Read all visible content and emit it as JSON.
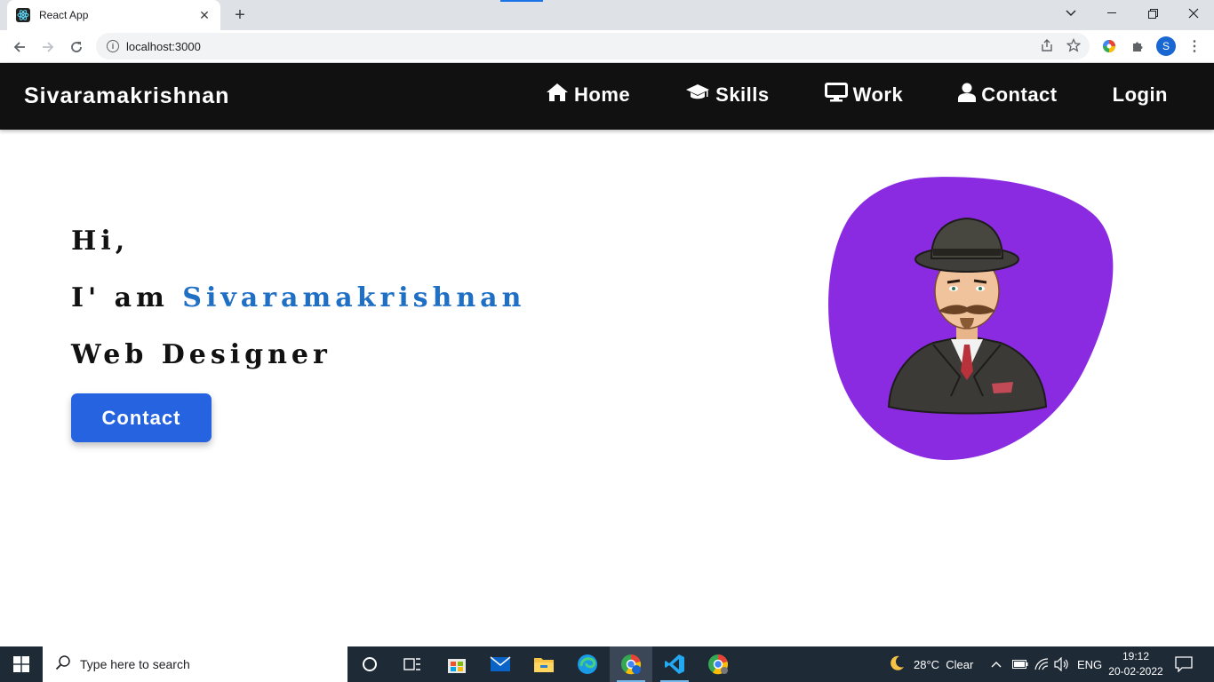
{
  "browser": {
    "tab_title": "React App",
    "url": "localhost:3000",
    "profile_initial": "S"
  },
  "site": {
    "brand": "Sivaramakrishnan",
    "menu": [
      {
        "label": "Home",
        "icon": "home-icon"
      },
      {
        "label": "Skills",
        "icon": "graduation-cap-icon"
      },
      {
        "label": "Work",
        "icon": "desktop-icon"
      },
      {
        "label": "Contact",
        "icon": "user-icon"
      },
      {
        "label": "Login",
        "icon": ""
      }
    ]
  },
  "hero": {
    "greeting": "Hi,",
    "intro_prefix": "I' am",
    "name": "Sivaramakrishnan",
    "role": "Web Designer",
    "contact_button": "Contact",
    "name_color": "#1f6fc5",
    "blob_color": "#8a2be2",
    "button_color": "#2563e0"
  },
  "taskbar": {
    "search_placeholder": "Type here to search",
    "weather": "28°C  Clear",
    "language": "ENG",
    "time": "19:12",
    "date": "20-02-2022"
  }
}
